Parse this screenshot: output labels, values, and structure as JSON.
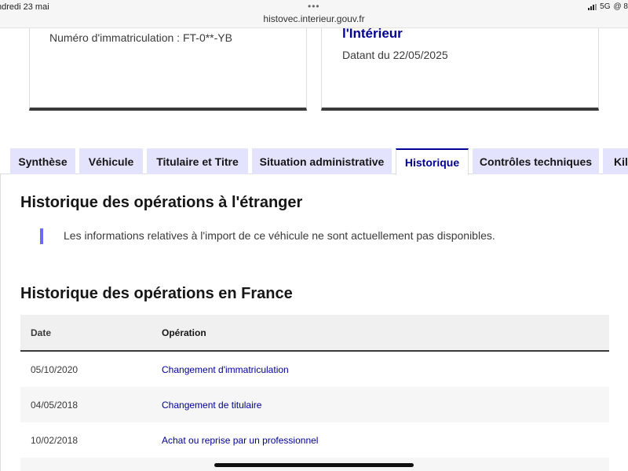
{
  "statusbar": {
    "date": "ndredi 23 mai",
    "dots": "•••",
    "url": "histovec.interieur.gouv.fr",
    "network": "5G",
    "extra": "@ 8"
  },
  "cards": {
    "left": {
      "immat": "Numéro d'immatriculation : FT-0**-YB"
    },
    "right": {
      "org": "l'Intérieur",
      "dated": "Datant du 22/05/2025"
    }
  },
  "tabs": [
    {
      "label": "Synthèse"
    },
    {
      "label": "Véhicule"
    },
    {
      "label": "Titulaire et Titre"
    },
    {
      "label": "Situation administrative"
    },
    {
      "label": "Historique"
    },
    {
      "label": "Contrôles techniques"
    },
    {
      "label": "Kilo"
    }
  ],
  "foreign": {
    "title": "Historique des opérations à l'étranger",
    "message": "Les informations relatives à l'import de ce véhicule ne sont actuellement pas disponibles."
  },
  "france": {
    "title": "Historique des opérations en France",
    "columns": [
      "Date",
      "Opération"
    ],
    "rows": [
      {
        "date": "05/10/2020",
        "operation": "Changement d'immatriculation"
      },
      {
        "date": "04/05/2018",
        "operation": "Changement de titulaire"
      },
      {
        "date": "10/02/2018",
        "operation": "Achat ou reprise par un professionnel"
      }
    ]
  },
  "colors": {
    "accent": "#000091",
    "tab_bg": "#e3e3fd",
    "quote_bar": "#6a6af4"
  }
}
